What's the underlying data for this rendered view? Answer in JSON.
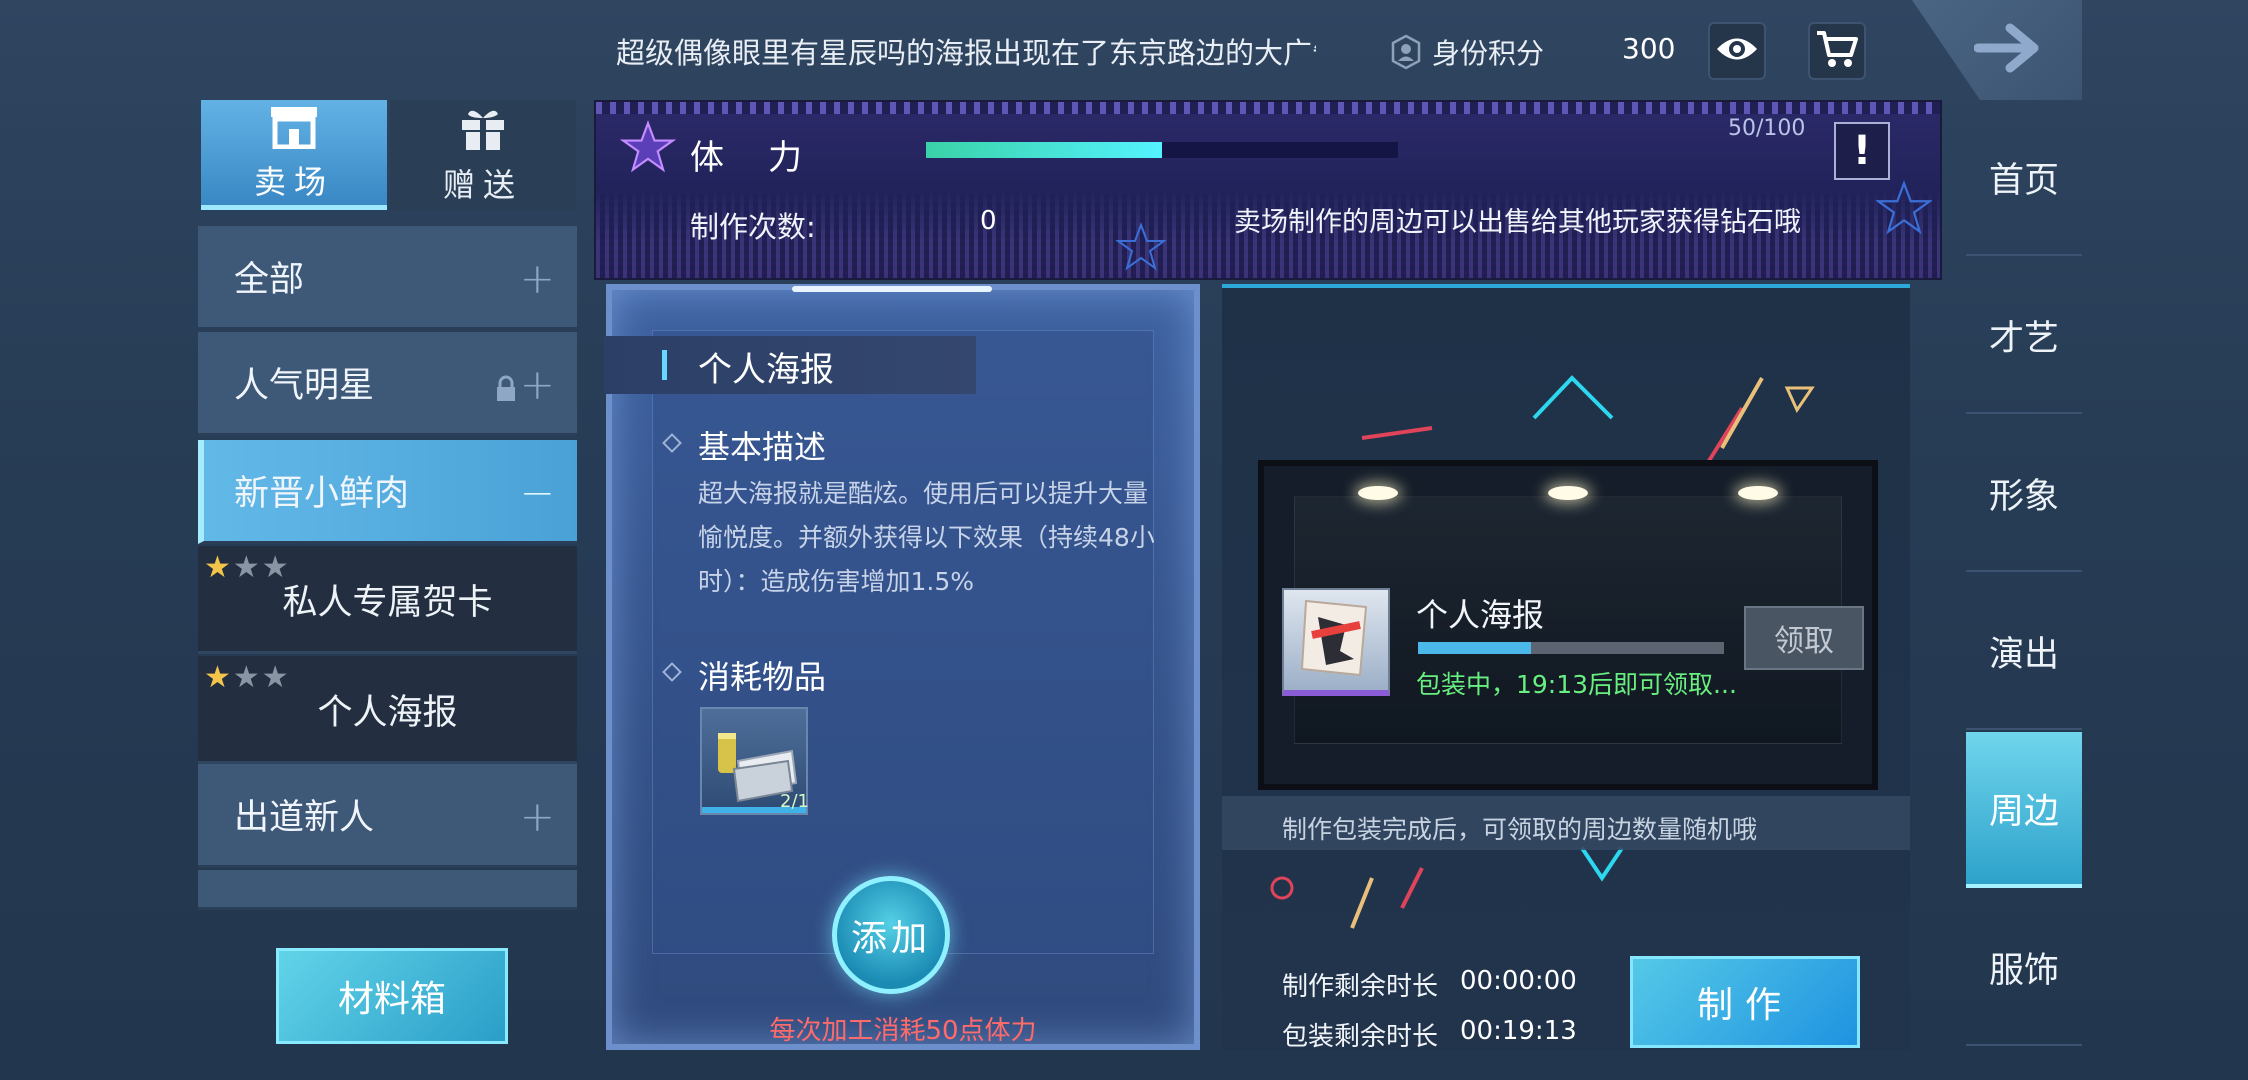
{
  "topbar": {
    "marquee": "超级偶像眼里有星辰吗的海报出现在了东京路边的大广告牌.",
    "id_label": "身份积分",
    "id_value": "300",
    "icons": [
      "id-badge-icon",
      "eye-icon",
      "cart-icon",
      "arrow-right-icon"
    ]
  },
  "tabs": [
    {
      "label": "卖场",
      "icon": "shop-icon",
      "active": true
    },
    {
      "label": "赠送",
      "icon": "gift-icon",
      "active": false
    }
  ],
  "categories": [
    {
      "label": "全部",
      "state": "collapsed"
    },
    {
      "label": "人气明星",
      "state": "locked"
    },
    {
      "label": "新晋小鲜肉",
      "state": "expanded"
    },
    {
      "label": "出道新人",
      "state": "collapsed"
    }
  ],
  "sub_items": [
    {
      "label": "私人专属贺卡",
      "stars_filled": 1,
      "stars_total": 3
    },
    {
      "label": "个人海报",
      "stars_filled": 1,
      "stars_total": 3
    }
  ],
  "material_button": "材料箱",
  "banner": {
    "stamina_label": "体力",
    "stamina_value": "50/100",
    "stamina_fraction": 0.5,
    "alert": "!",
    "craft_label": "制作次数:",
    "craft_value": "0",
    "tip": "卖场制作的周边可以出售给其他玩家获得钻石哦"
  },
  "detail": {
    "title": "个人海报",
    "basic_heading": "基本描述",
    "basic_desc": "超大海报就是酷炫。使用后可以提升大量愉悦度。并额外获得以下效果（持续48小时）：造成伤害增加1.5%",
    "consume_heading": "消耗物品",
    "consume_count": "2/1",
    "add_button": "添加",
    "note": "每次加工消耗50点体力"
  },
  "production": {
    "item_name": "个人海报",
    "progress_fraction": 0.37,
    "status": "包装中，19:13后即可领取...",
    "claim_button": "领取",
    "tip": "制作包装完成后，可领取的周边数量随机哦",
    "remain_craft_label": "制作剩余时长",
    "remain_craft_value": "00:00:00",
    "remain_pack_label": "包装剩余时长",
    "remain_pack_value": "00:19:13",
    "make_button": "制作"
  },
  "nav": [
    {
      "label": "首页",
      "active": false
    },
    {
      "label": "才艺",
      "active": false
    },
    {
      "label": "形象",
      "active": false
    },
    {
      "label": "演出",
      "active": false
    },
    {
      "label": "周边",
      "active": true
    },
    {
      "label": "服饰",
      "active": false
    }
  ],
  "colors": {
    "accent": "#4aa1d6",
    "stamina_bar": "#54f2ff",
    "status_green": "#67f07f",
    "warning_red": "#ff6a6a"
  }
}
